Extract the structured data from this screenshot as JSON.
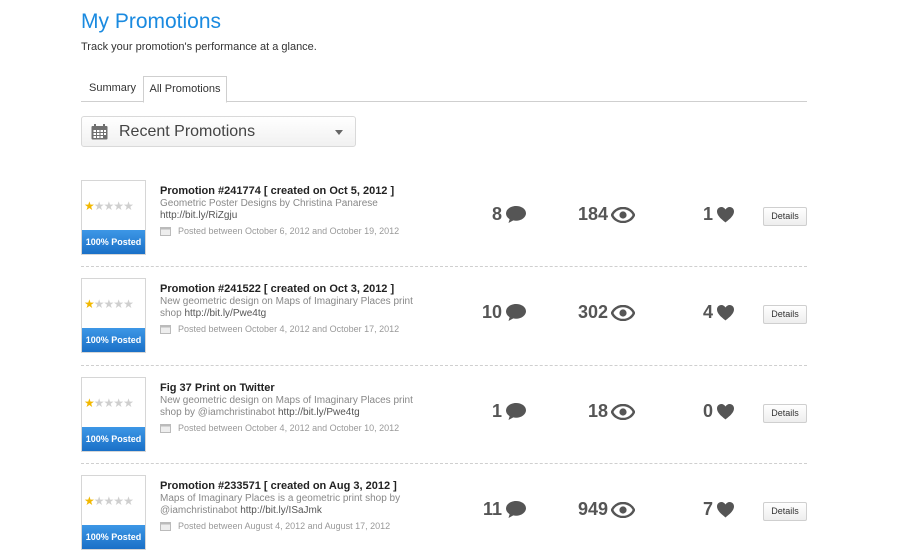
{
  "header": {
    "title": "My Promotions",
    "subtitle": "Track your promotion's performance at a glance."
  },
  "tabs": [
    {
      "label": "Summary",
      "active": false
    },
    {
      "label": "All Promotions",
      "active": true
    }
  ],
  "filter": {
    "selected": "Recent Promotions",
    "icon": "calendar-icon"
  },
  "colors": {
    "title_blue": "#1a8ae0",
    "badge_blue": "#1a70c7",
    "star_gold": "#f2b800"
  },
  "promotions": [
    {
      "title": "Promotion #241774 [ created on Oct 5, 2012 ]",
      "description": "Geometric Poster Designs by Christina Panarese",
      "link": "http://bit.ly/RiZgju",
      "posted_range": "Posted between October 6, 2012 and October 19, 2012",
      "rating": 1,
      "badge": "100% Posted",
      "comments": "8",
      "views": "184",
      "likes": "1",
      "details_label": "Details"
    },
    {
      "title": "Promotion #241522 [ created on Oct 3, 2012 ]",
      "description": "New geometric design on Maps of Imaginary Places print shop",
      "link": "http://bit.ly/Pwe4tg",
      "posted_range": "Posted between October 4, 2012 and October 17, 2012",
      "rating": 1,
      "badge": "100% Posted",
      "comments": "10",
      "views": "302",
      "likes": "4",
      "details_label": "Details"
    },
    {
      "title": "Fig 37 Print on Twitter",
      "description": "New geometric design on Maps of Imaginary Places print shop by @iamchristinabot",
      "link": "http://bit.ly/Pwe4tg",
      "posted_range": "Posted between October 4, 2012 and October 10, 2012",
      "rating": 1,
      "badge": "100% Posted",
      "comments": "1",
      "views": "18",
      "likes": "0",
      "details_label": "Details"
    },
    {
      "title": "Promotion #233571 [ created on Aug 3, 2012 ]",
      "description": "Maps of Imaginary Places is a geometric print shop by @iamchristinabot",
      "link": "http://bit.ly/ISaJmk",
      "posted_range": "Posted between August 4, 2012 and August 17, 2012",
      "rating": 1,
      "badge": "100% Posted",
      "comments": "11",
      "views": "949",
      "likes": "7",
      "details_label": "Details"
    }
  ]
}
